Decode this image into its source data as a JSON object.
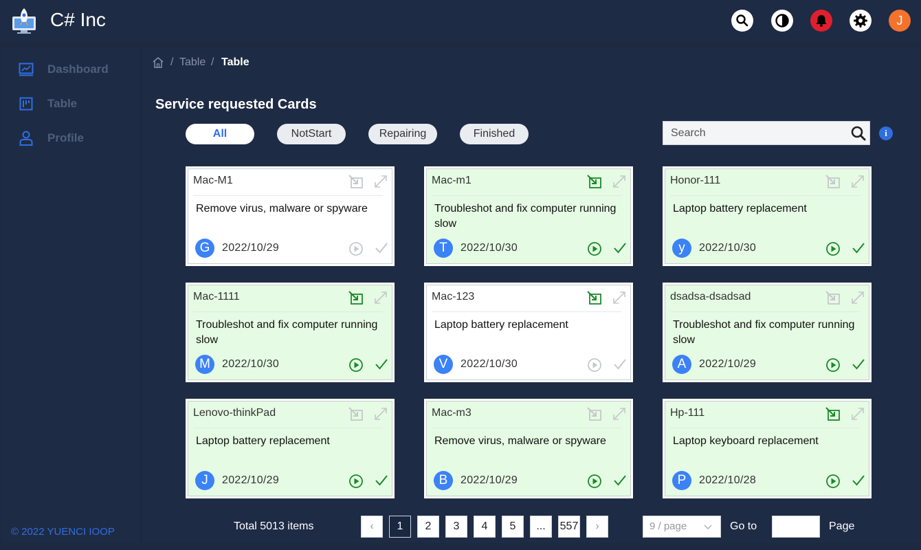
{
  "app": {
    "title": "C# Inc"
  },
  "header": {
    "avatar_initial": "J"
  },
  "sidebar": {
    "items": [
      {
        "label": "Dashboard"
      },
      {
        "label": "Table"
      },
      {
        "label": "Profile"
      }
    ],
    "copyright": "© 2022 YUENCI IOOP"
  },
  "breadcrumb": {
    "level1": "Table",
    "current": "Table",
    "separator": "/"
  },
  "main": {
    "title": "Service requested Cards",
    "filters": [
      "All",
      "NotStart",
      "Repairing",
      "Finished"
    ],
    "active_filter": "All",
    "search_placeholder": "Search",
    "info_glyph": "i"
  },
  "cards": [
    {
      "name": "Mac-M1",
      "desc": "Remove virus, malware or spyware",
      "avatar": "G",
      "date": "2022/10/29",
      "state": "notstart"
    },
    {
      "name": "Mac-m1",
      "desc": "Troubleshot and fix computer running slow",
      "avatar": "T",
      "date": "2022/10/30",
      "state": "finished"
    },
    {
      "name": "Honor-111",
      "desc": "Laptop battery replacement",
      "avatar": "y",
      "date": "2022/10/30",
      "state": "done"
    },
    {
      "name": "Mac-1111",
      "desc": "Troubleshot and fix computer running slow",
      "avatar": "M",
      "date": "2022/10/30",
      "state": "finished"
    },
    {
      "name": "Mac-123",
      "desc": "Laptop battery replacement",
      "avatar": "V",
      "date": "2022/10/30",
      "state": "assigned"
    },
    {
      "name": "dsadsa-dsadsad",
      "desc": "Troubleshot and fix computer running slow",
      "avatar": "A",
      "date": "2022/10/29",
      "state": "done"
    },
    {
      "name": "Lenovo-thinkPad",
      "desc": "Laptop battery replacement",
      "avatar": "J",
      "date": "2022/10/29",
      "state": "done"
    },
    {
      "name": "Mac-m3",
      "desc": "Remove virus, malware or spyware",
      "avatar": "B",
      "date": "2022/10/29",
      "state": "done"
    },
    {
      "name": "Hp-111",
      "desc": "Laptop keyboard replacement",
      "avatar": "P",
      "date": "2022/10/28",
      "state": "finished"
    }
  ],
  "pagination": {
    "total_text": "Total 5013 items",
    "prev": "‹",
    "next": "›",
    "pages": [
      "1",
      "2",
      "3",
      "4",
      "5",
      "...",
      "557"
    ],
    "current": "1",
    "page_size": "9 / page",
    "goto_label": "Go to",
    "page_label": "Page"
  },
  "colors": {
    "accent": "#2d6ef0",
    "card_green": "#e5fbe3",
    "action_green": "#1a8a2a",
    "action_gray": "#c5c8cc",
    "avatar_blue": "#3b82f6",
    "bell_red": "#e01f2d",
    "user_orange": "#f4732c"
  }
}
